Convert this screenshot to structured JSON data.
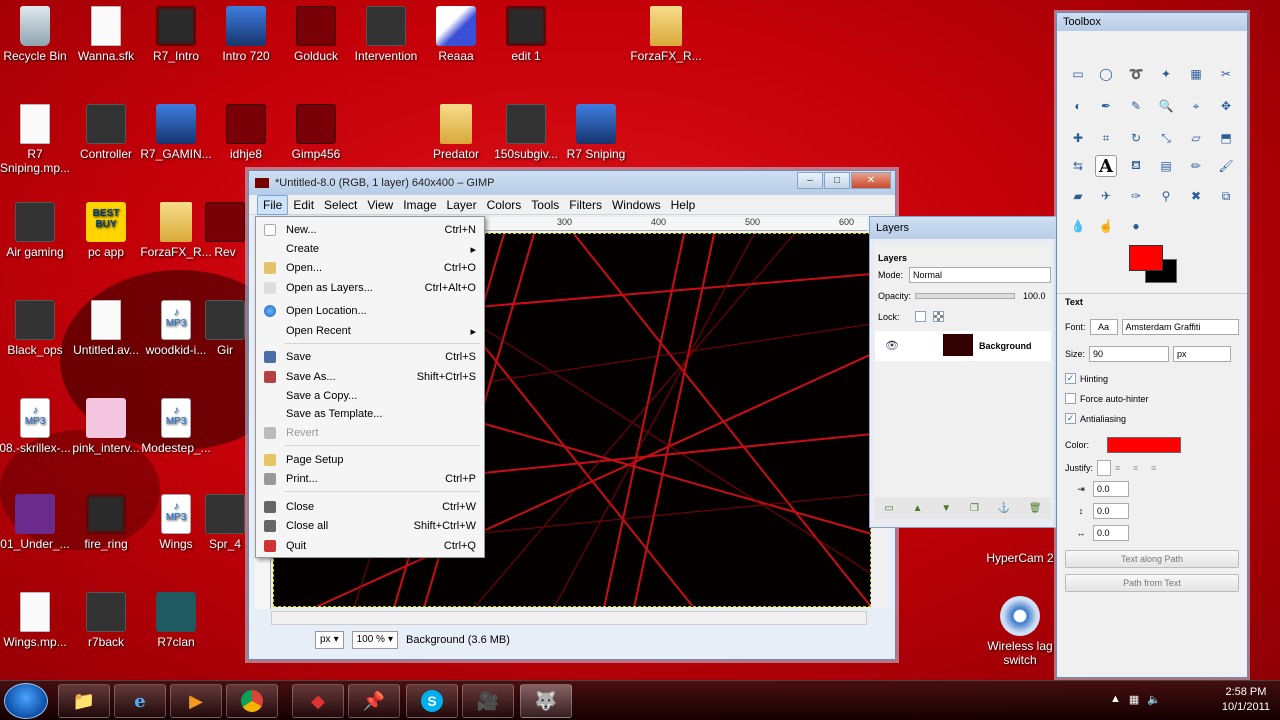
{
  "desktop_icons": [
    {
      "label": "Recycle Bin"
    },
    {
      "label": "Wanna.sfk"
    },
    {
      "label": "R7_Intro"
    },
    {
      "label": "Intro 720"
    },
    {
      "label": "Golduck"
    },
    {
      "label": "Intervention"
    },
    {
      "label": "Reaaa"
    },
    {
      "label": "edit 1"
    },
    {
      "label": "ForzaFX_R..."
    },
    {
      "label": "R7 Sniping.mp..."
    },
    {
      "label": "Controller"
    },
    {
      "label": "R7_GAMIN..."
    },
    {
      "label": "idhje8"
    },
    {
      "label": "Gimp456"
    },
    {
      "label": "Predator"
    },
    {
      "label": "150subgiv..."
    },
    {
      "label": "R7 Sniping"
    },
    {
      "label": "Air gaming"
    },
    {
      "label": "pc app"
    },
    {
      "label": "ForzaFX_R..."
    },
    {
      "label": "Rev"
    },
    {
      "label": "Black_ops"
    },
    {
      "label": "Untitled.av..."
    },
    {
      "label": "woodkid-i..."
    },
    {
      "label": "Gir"
    },
    {
      "label": "08.-skrillex-..."
    },
    {
      "label": "pink_interv..."
    },
    {
      "label": "Modestep_..."
    },
    {
      "label": "01_Under_..."
    },
    {
      "label": "fire_ring"
    },
    {
      "label": "Wings"
    },
    {
      "label": "Spr_4"
    },
    {
      "label": "Wings.mp..."
    },
    {
      "label": "r7back"
    },
    {
      "label": "R7clan"
    },
    {
      "label": "HyperCam 2"
    },
    {
      "label": "Wireless lag switch"
    }
  ],
  "gimp": {
    "title": "*Untitled-8.0 (RGB, 1 layer) 640x400 – GIMP",
    "menus": [
      "File",
      "Edit",
      "Select",
      "View",
      "Image",
      "Layer",
      "Colors",
      "Tools",
      "Filters",
      "Windows",
      "Help"
    ],
    "ruler_ticks": [
      "300",
      "400",
      "500",
      "600"
    ],
    "status": {
      "unit": "px",
      "zoom": "100 %",
      "info": "Background (3.6 MB)"
    }
  },
  "file_menu": [
    {
      "label": "New...",
      "shortcut": "Ctrl+N"
    },
    {
      "label": "Create",
      "shortcut": "▸"
    },
    {
      "label": "Open...",
      "shortcut": "Ctrl+O"
    },
    {
      "label": "Open as Layers...",
      "shortcut": "Ctrl+Alt+O"
    },
    {
      "label": "Open Location...",
      "shortcut": ""
    },
    {
      "label": "Open Recent",
      "shortcut": "▸"
    },
    {
      "label": "Save",
      "shortcut": "Ctrl+S"
    },
    {
      "label": "Save As...",
      "shortcut": "Shift+Ctrl+S"
    },
    {
      "label": "Save a Copy...",
      "shortcut": ""
    },
    {
      "label": "Save as Template...",
      "shortcut": ""
    },
    {
      "label": "Revert",
      "shortcut": ""
    },
    {
      "label": "Page Setup",
      "shortcut": ""
    },
    {
      "label": "Print...",
      "shortcut": "Ctrl+P"
    },
    {
      "label": "Close",
      "shortcut": "Ctrl+W"
    },
    {
      "label": "Close all",
      "shortcut": "Shift+Ctrl+W"
    },
    {
      "label": "Quit",
      "shortcut": "Ctrl+Q"
    }
  ],
  "layers": {
    "window_title": "Layers",
    "tab": "Layers",
    "mode_label": "Mode:",
    "mode_value": "Normal",
    "opacity_label": "Opacity:",
    "opacity_value": "100.0",
    "lock_label": "Lock:",
    "layer_name": "Background"
  },
  "toolbox": {
    "title": "Toolbox",
    "fg_color": "#ff0000",
    "bg_color": "#000000",
    "text_section": "Text",
    "font_label": "Font:",
    "font_value": "Amsterdam Graffiti",
    "size_label": "Size:",
    "size_value": "90",
    "size_unit": "px",
    "hinting": "Hinting",
    "force_autohinter": "Force auto-hinter",
    "antialiasing": "Antialiasing",
    "color_label": "Color:",
    "text_color": "#ff0000",
    "justify_label": "Justify:",
    "indent": "0.0",
    "line_spacing": "0.0",
    "letter_spacing": "0.0",
    "text_along_path": "Text along Path",
    "path_from_text": "Path from Text"
  },
  "taskbar": {
    "time": "2:58 PM",
    "date": "10/1/2011"
  }
}
